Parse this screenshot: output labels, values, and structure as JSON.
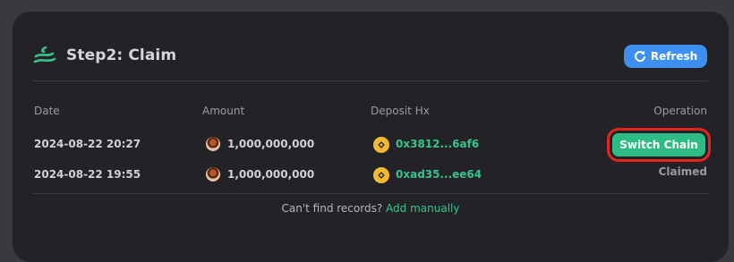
{
  "header": {
    "title": "Step2: Claim",
    "refresh_label": "Refresh"
  },
  "table": {
    "columns": {
      "date": "Date",
      "amount": "Amount",
      "deposit_hx": "Deposit Hx",
      "operation": "Operation"
    },
    "rows": [
      {
        "date": "2024-08-22 20:27",
        "amount": "1,000,000,000",
        "hash": "0x3812...6af6",
        "operation_label": "Switch Chain"
      },
      {
        "date": "2024-08-22 19:55",
        "amount": "1,000,000,000",
        "hash": "0xad35...ee64",
        "operation_label": "Claimed"
      }
    ]
  },
  "footer": {
    "prompt": "Can't find records?",
    "link_label": "Add manually"
  },
  "colors": {
    "card_background": "#232327",
    "accent_green": "#37c48c",
    "refresh_blue": "#3d8ff0",
    "highlight_red": "#e3241f"
  },
  "icons": {
    "step": "wave-stack-icon",
    "refresh": "refresh-icon",
    "token": "token-avatar-icon",
    "chain": "bnb-icon"
  }
}
